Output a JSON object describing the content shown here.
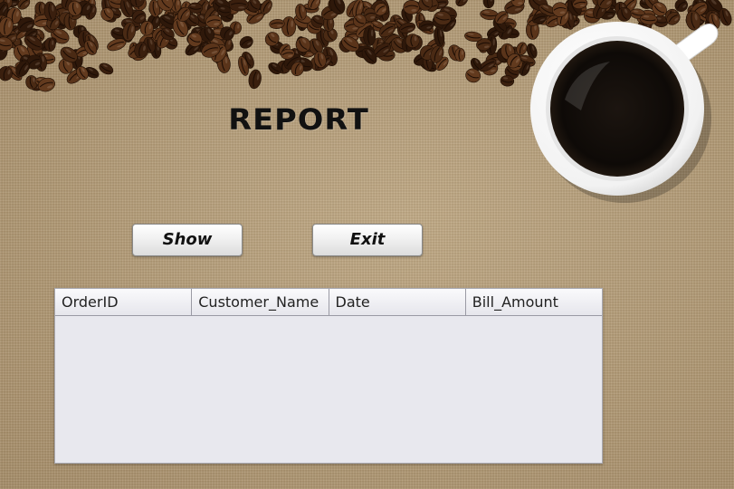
{
  "title": "REPORT",
  "buttons": {
    "show": "Show",
    "exit": "Exit"
  },
  "table": {
    "columns": [
      "OrderID",
      "Customer_Name",
      "Date",
      "Bill_Amount"
    ],
    "rows": []
  },
  "icons": {
    "beans": "coffee-beans-icon",
    "cup": "coffee-cup-icon"
  },
  "colors": {
    "background": "#b39a74",
    "bean": "#4a2a14",
    "table_bg": "#e8e8ee"
  }
}
